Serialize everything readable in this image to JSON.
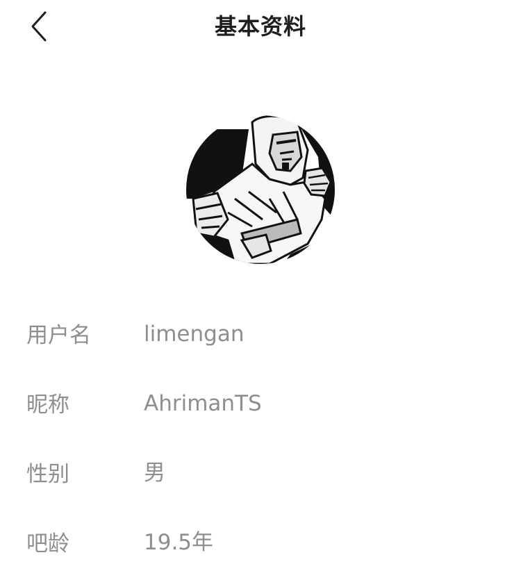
{
  "header": {
    "title": "基本资料",
    "back_icon": "chevron-left-icon"
  },
  "avatar": {
    "description_icon": "user-avatar-image"
  },
  "profile": {
    "rows": [
      {
        "label": "用户名",
        "value": "limengan"
      },
      {
        "label": "昵称",
        "value": "AhrimanTS"
      },
      {
        "label": "性别",
        "value": "男"
      },
      {
        "label": "吧龄",
        "value": "19.5年"
      }
    ]
  },
  "colors": {
    "title": "#1e1e1e",
    "label": "#8e8e8e",
    "value": "#8e8e8e",
    "background": "#ffffff"
  }
}
